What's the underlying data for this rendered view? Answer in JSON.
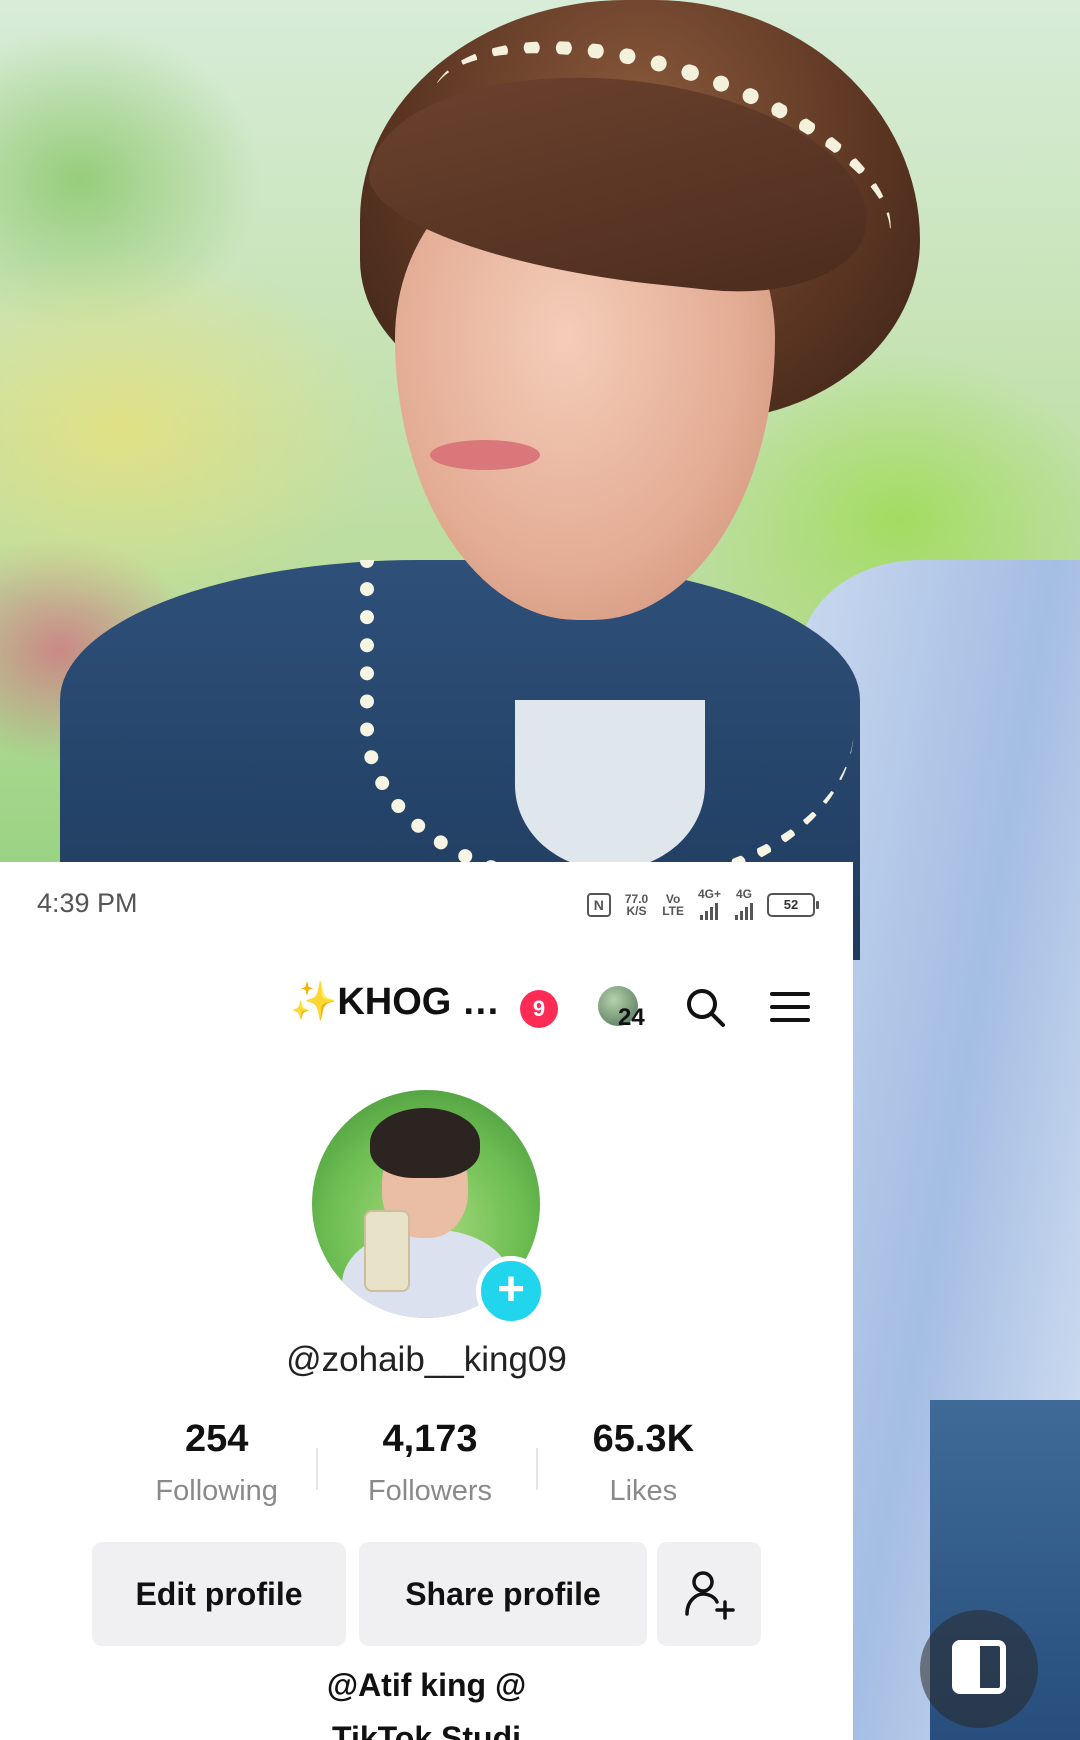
{
  "status_bar": {
    "time": "4:39 PM",
    "net_speed": "77.0",
    "net_unit": "K/S",
    "volte_top": "Vo",
    "volte_bottom": "LTE",
    "signal1": "4G+",
    "signal2": "4G",
    "battery": "52"
  },
  "header": {
    "display_name": "✨KHOG …",
    "notification_count": "9",
    "story_count": "24"
  },
  "profile": {
    "username": "@zohaib__king09",
    "bio_line1": "@Atif king @",
    "bio_line2": "TikTok Studi"
  },
  "stats": [
    {
      "value": "254",
      "label": "Following"
    },
    {
      "value": "4,173",
      "label": "Followers"
    },
    {
      "value": "65.3K",
      "label": "Likes"
    }
  ],
  "actions": {
    "edit_label": "Edit profile",
    "share_label": "Share profile"
  },
  "colors": {
    "accent_badge": "#fe2c55",
    "plus_button": "#20d5ec",
    "button_bg": "#f0f0f2"
  }
}
